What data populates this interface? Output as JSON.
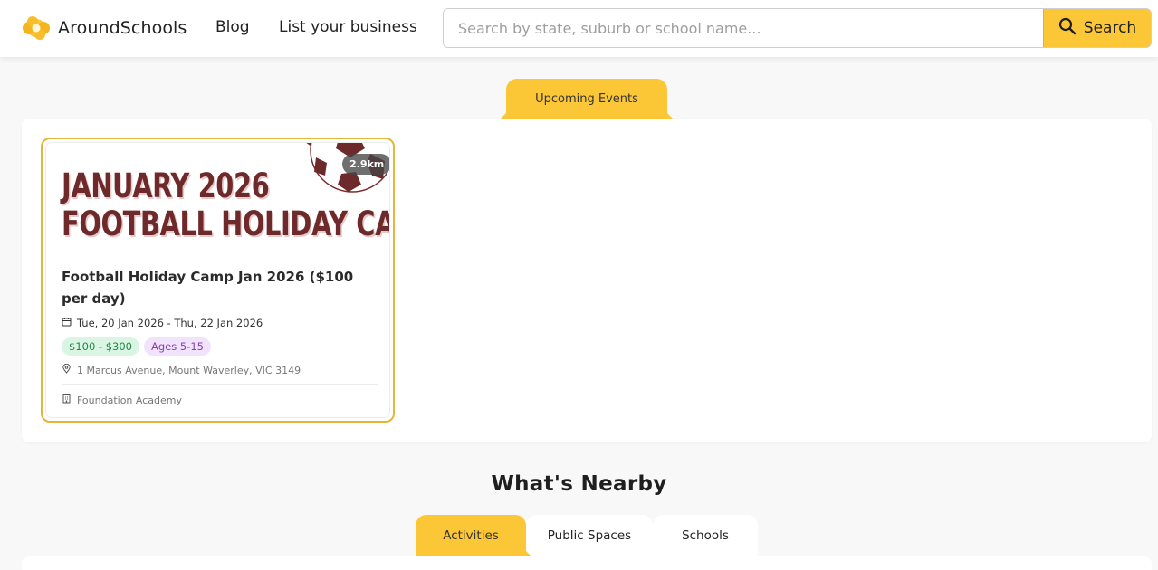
{
  "brand": {
    "name": "AroundSchools",
    "accent": "#fcc737",
    "logo_icon": "flower-logo-icon"
  },
  "nav": {
    "blog": "Blog",
    "list_business": "List your business"
  },
  "search": {
    "placeholder": "Search by state, suburb or school name...",
    "value": "",
    "button_label": "Search",
    "icon": "magnifier-icon"
  },
  "events": {
    "tab_label": "Upcoming Events",
    "items": [
      {
        "banner_line1": "JANUARY 2026",
        "banner_line2": "FOOTBALL HOLIDAY CAMP",
        "distance": "2.9km",
        "title": "Football Holiday Camp Jan 2026 ($100 per day)",
        "dates": "Tue, 20 Jan 2026 - Thu, 22 Jan 2026",
        "price": "$100 - $300",
        "ages": "Ages 5-15",
        "address": "1 Marcus Avenue, Mount Waverley, VIC 3149",
        "organization": "Foundation Academy",
        "icons": {
          "date": "calendar-icon",
          "address": "map-pin-icon",
          "organization": "building-icon",
          "banner": "soccer-ball-icon"
        }
      }
    ]
  },
  "nearby": {
    "title": "What's Nearby",
    "tabs": [
      {
        "label": "Activities",
        "active": true
      },
      {
        "label": "Public Spaces",
        "active": false
      },
      {
        "label": "Schools",
        "active": false
      }
    ]
  }
}
